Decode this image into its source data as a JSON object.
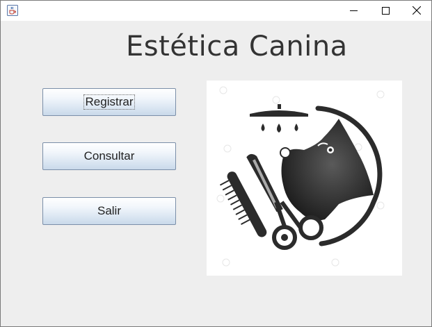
{
  "window": {
    "icon": "java-cup-icon",
    "controls": [
      "minimize-icon",
      "maximize-icon",
      "close-icon"
    ]
  },
  "header": {
    "title": "Estética Canina"
  },
  "menu": {
    "register_label": "Registrar",
    "consult_label": "Consultar",
    "exit_label": "Salir"
  },
  "illustration": {
    "subject": "dog-grooming-logo",
    "colors": {
      "primary": "#2b2b2b",
      "background": "#ffffff"
    }
  },
  "colors": {
    "window_bg": "#eeeeee",
    "title_text": "#333333",
    "button_border": "#7a8ea8"
  }
}
